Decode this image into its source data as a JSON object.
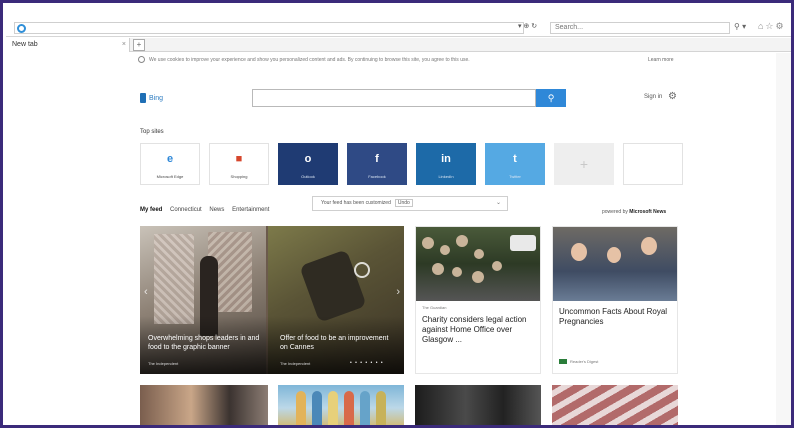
{
  "browser": {
    "address_placeholder": "",
    "search_placeholder": "Search...",
    "tab_title": "New tab",
    "tab_close": "×",
    "new_tab": "+"
  },
  "notice": {
    "text": "We use cookies to improve your experience and show you personalized content and ads. By continuing to browse this site, you agree to this use.",
    "learn_more": "Learn more"
  },
  "header": {
    "logo_text": "Bing",
    "search_value": "",
    "sign_in": "Sign in"
  },
  "top_sites": {
    "label": "Top sites",
    "tiles": [
      {
        "name": "Microsoft Edge",
        "glyph": "e",
        "bg": "#ffffff",
        "fg": "#2f88d8"
      },
      {
        "name": "Shopping",
        "glyph": "■",
        "bg": "#ffffff",
        "fg": "#d6462c"
      },
      {
        "name": "Outlook",
        "glyph": "o",
        "bg": "#1f3b73",
        "fg": "#ffffff"
      },
      {
        "name": "Facebook",
        "glyph": "f",
        "bg": "#2f4a85",
        "fg": "#ffffff"
      },
      {
        "name": "LinkedIn",
        "glyph": "in",
        "bg": "#1d6aa8",
        "fg": "#ffffff"
      },
      {
        "name": "Twitter",
        "glyph": "t",
        "bg": "#55a9e3",
        "fg": "#ffffff"
      },
      {
        "name": "",
        "glyph": "+",
        "bg": "#eeeeee",
        "fg": "#c0c0c0"
      },
      {
        "name": "",
        "glyph": "",
        "bg": "#ffffff",
        "fg": "#ffffff"
      }
    ]
  },
  "feed": {
    "nav": [
      "My feed",
      "Connecticut",
      "News",
      "Entertainment"
    ],
    "tooltip": "Your feed has been customized",
    "tooltip_button": "Undo",
    "powered_by": "powered by",
    "powered_brand": "Microsoft News"
  },
  "cards": {
    "hero_left_title": "Overwhelming shops leaders in and food to the graphic banner",
    "hero_left_source": "The Independent",
    "hero_right_title": "Offer of food to be an improvement on Cannes",
    "hero_right_source": "The Independent",
    "news_source": "The Guardian",
    "news_title": "Charity considers legal action against Home Office over Glasgow ...",
    "royal_title": "Uncommon Facts About Royal Pregnancies",
    "royal_source": "Reader's Digest"
  }
}
